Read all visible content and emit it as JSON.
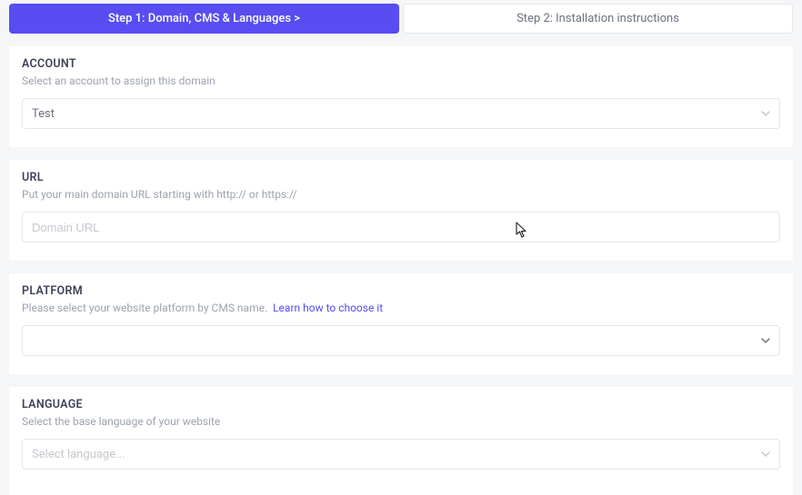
{
  "stepper": {
    "step1": "Step 1: Domain, CMS & Languages  >",
    "step2": "Step 2: Installation instructions"
  },
  "account": {
    "title": "ACCOUNT",
    "desc": "Select an account to assign this domain",
    "value": "Test"
  },
  "url": {
    "title": "URL",
    "desc": "Put your main domain URL starting with http:// or https://",
    "placeholder": "Domain URL"
  },
  "platform": {
    "title": "PLATFORM",
    "desc": "Please select your website platform by CMS name.",
    "link": "Learn how to choose it",
    "value": ""
  },
  "language": {
    "title": "LANGUAGE",
    "desc": "Select the base language of your website",
    "placeholder": "Select language..."
  }
}
